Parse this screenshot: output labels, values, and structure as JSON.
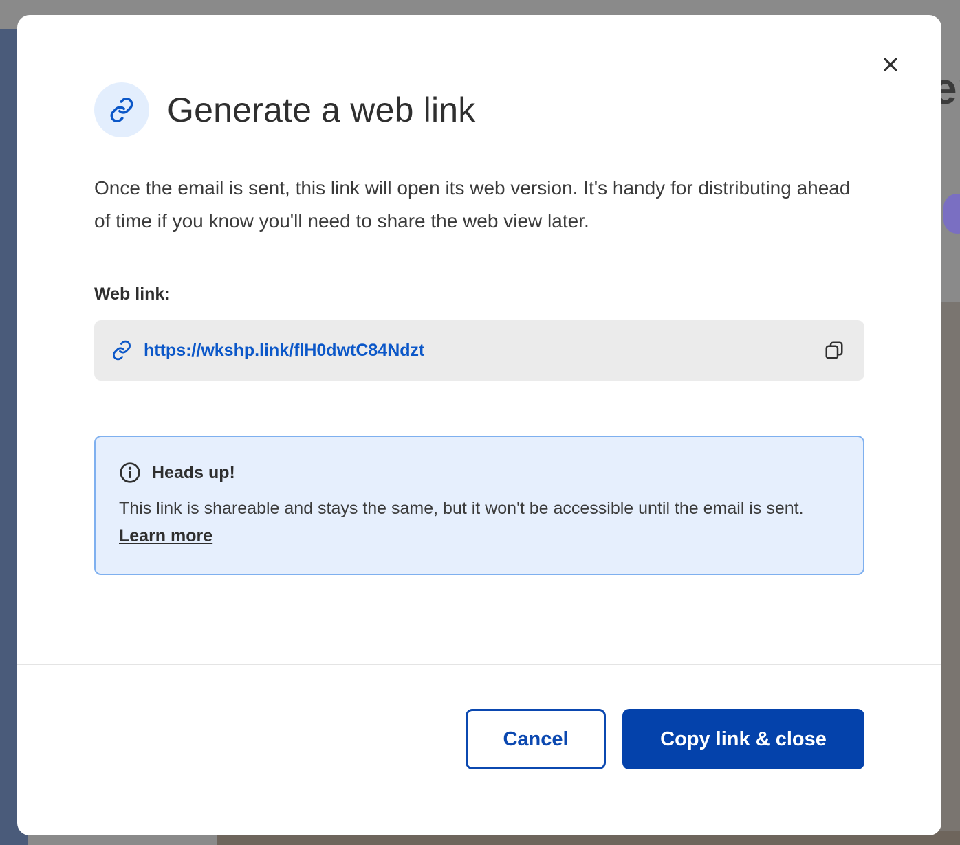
{
  "dialog": {
    "title": "Generate a web link",
    "description": "Once the email is sent, this link will open its web version. It's handy for distributing ahead of time if you know you'll need to share the web view later.",
    "field_label": "Web link:",
    "link_url": "https://wkshp.link/flH0dwtC84Ndzt",
    "notice": {
      "title": "Heads up!",
      "body": "This link is shareable and stays the same, but it won't be accessible until the email is sent.",
      "learn_more": "Learn more"
    },
    "buttons": {
      "cancel": "Cancel",
      "primary": "Copy link & close"
    }
  },
  "background": {
    "heading_fragment": "en"
  },
  "icons": {
    "close": "close-icon",
    "header": "link-icon",
    "field": "link-icon",
    "copy": "copy-icon",
    "notice": "info-icon"
  },
  "colors": {
    "accent": "#0442ab",
    "link": "#0b57c8",
    "notice_bg": "#e6effd",
    "notice_border": "#7fb0ef",
    "icon_circle_bg": "#e3eefd"
  }
}
